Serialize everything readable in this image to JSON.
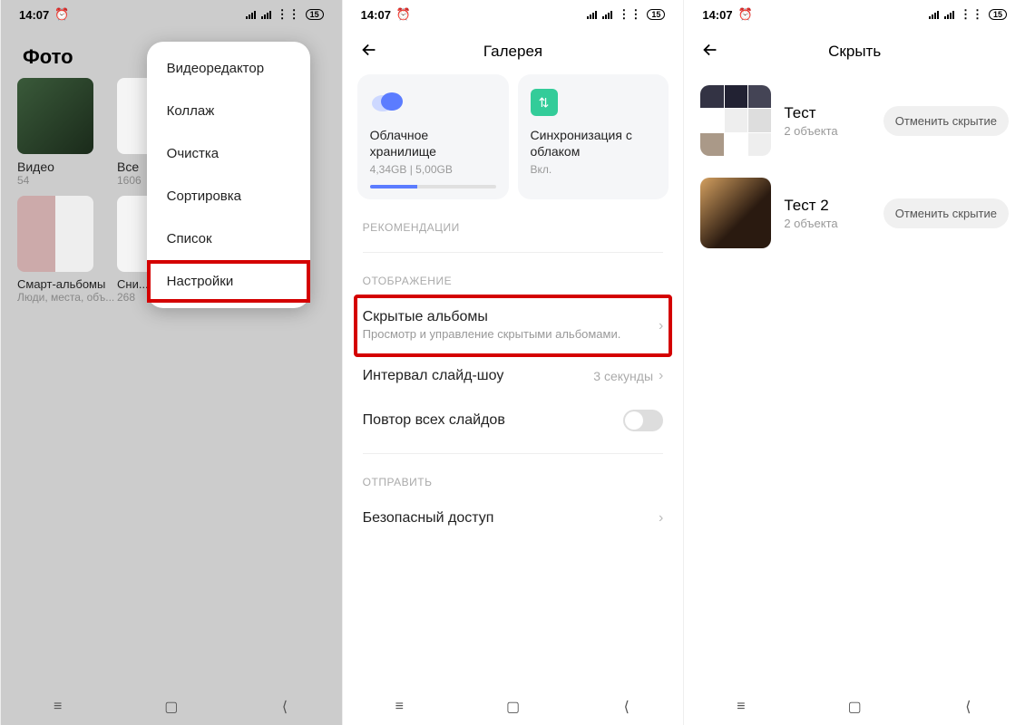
{
  "status": {
    "time": "14:07",
    "battery": "15"
  },
  "p1": {
    "title": "Фото",
    "albums": [
      {
        "name": "Видео",
        "count": "54"
      },
      {
        "name": "Все",
        "count": "1606"
      },
      {
        "name": "Смарт-альбомы",
        "count": "Люди, места, объ..."
      },
      {
        "name": "Снимки и записи экрана",
        "count": "268"
      }
    ],
    "menu": [
      "Видеоредактор",
      "Коллаж",
      "Очистка",
      "Сортировка",
      "Список",
      "Настройки"
    ]
  },
  "p2": {
    "title": "Галерея",
    "card1": {
      "t": "Облачное хранилище",
      "s": "4,34GB  |  5,00GB"
    },
    "card2": {
      "t": "Синхронизация с облаком",
      "s": "Вкл."
    },
    "sec1": "РЕКОМЕНДАЦИИ",
    "sec2": "ОТОБРАЖЕНИЕ",
    "hidden": {
      "t": "Скрытые альбомы",
      "s": "Просмотр и управление скрытыми альбомами."
    },
    "slideshow": {
      "t": "Интервал слайд-шоу",
      "v": "3 секунды"
    },
    "repeat": "Повтор всех слайдов",
    "sec3": "ОТПРАВИТЬ",
    "secure": "Безопасный доступ"
  },
  "p3": {
    "title": "Скрыть",
    "items": [
      {
        "t": "Тест",
        "s": "2 объекта"
      },
      {
        "t": "Тест 2",
        "s": "2 объекта"
      }
    ],
    "btn": "Отменить скрытие"
  }
}
